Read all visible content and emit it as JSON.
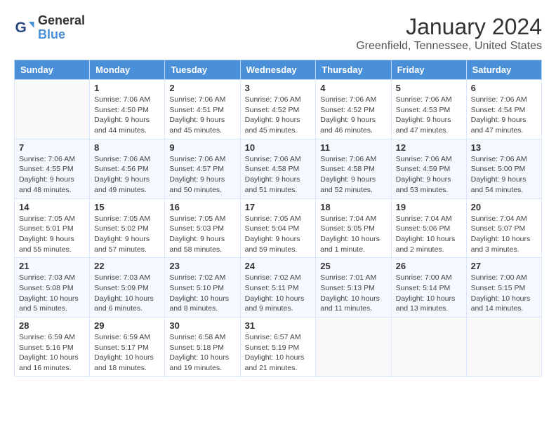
{
  "logo": {
    "line1": "General",
    "line2": "Blue"
  },
  "title": "January 2024",
  "subtitle": "Greenfield, Tennessee, United States",
  "weekdays": [
    "Sunday",
    "Monday",
    "Tuesday",
    "Wednesday",
    "Thursday",
    "Friday",
    "Saturday"
  ],
  "weeks": [
    [
      {
        "date": "",
        "info": ""
      },
      {
        "date": "1",
        "info": "Sunrise: 7:06 AM\nSunset: 4:50 PM\nDaylight: 9 hours\nand 44 minutes."
      },
      {
        "date": "2",
        "info": "Sunrise: 7:06 AM\nSunset: 4:51 PM\nDaylight: 9 hours\nand 45 minutes."
      },
      {
        "date": "3",
        "info": "Sunrise: 7:06 AM\nSunset: 4:52 PM\nDaylight: 9 hours\nand 45 minutes."
      },
      {
        "date": "4",
        "info": "Sunrise: 7:06 AM\nSunset: 4:52 PM\nDaylight: 9 hours\nand 46 minutes."
      },
      {
        "date": "5",
        "info": "Sunrise: 7:06 AM\nSunset: 4:53 PM\nDaylight: 9 hours\nand 47 minutes."
      },
      {
        "date": "6",
        "info": "Sunrise: 7:06 AM\nSunset: 4:54 PM\nDaylight: 9 hours\nand 47 minutes."
      }
    ],
    [
      {
        "date": "7",
        "info": "Sunrise: 7:06 AM\nSunset: 4:55 PM\nDaylight: 9 hours\nand 48 minutes."
      },
      {
        "date": "8",
        "info": "Sunrise: 7:06 AM\nSunset: 4:56 PM\nDaylight: 9 hours\nand 49 minutes."
      },
      {
        "date": "9",
        "info": "Sunrise: 7:06 AM\nSunset: 4:57 PM\nDaylight: 9 hours\nand 50 minutes."
      },
      {
        "date": "10",
        "info": "Sunrise: 7:06 AM\nSunset: 4:58 PM\nDaylight: 9 hours\nand 51 minutes."
      },
      {
        "date": "11",
        "info": "Sunrise: 7:06 AM\nSunset: 4:58 PM\nDaylight: 9 hours\nand 52 minutes."
      },
      {
        "date": "12",
        "info": "Sunrise: 7:06 AM\nSunset: 4:59 PM\nDaylight: 9 hours\nand 53 minutes."
      },
      {
        "date": "13",
        "info": "Sunrise: 7:06 AM\nSunset: 5:00 PM\nDaylight: 9 hours\nand 54 minutes."
      }
    ],
    [
      {
        "date": "14",
        "info": "Sunrise: 7:05 AM\nSunset: 5:01 PM\nDaylight: 9 hours\nand 55 minutes."
      },
      {
        "date": "15",
        "info": "Sunrise: 7:05 AM\nSunset: 5:02 PM\nDaylight: 9 hours\nand 57 minutes."
      },
      {
        "date": "16",
        "info": "Sunrise: 7:05 AM\nSunset: 5:03 PM\nDaylight: 9 hours\nand 58 minutes."
      },
      {
        "date": "17",
        "info": "Sunrise: 7:05 AM\nSunset: 5:04 PM\nDaylight: 9 hours\nand 59 minutes."
      },
      {
        "date": "18",
        "info": "Sunrise: 7:04 AM\nSunset: 5:05 PM\nDaylight: 10 hours\nand 1 minute."
      },
      {
        "date": "19",
        "info": "Sunrise: 7:04 AM\nSunset: 5:06 PM\nDaylight: 10 hours\nand 2 minutes."
      },
      {
        "date": "20",
        "info": "Sunrise: 7:04 AM\nSunset: 5:07 PM\nDaylight: 10 hours\nand 3 minutes."
      }
    ],
    [
      {
        "date": "21",
        "info": "Sunrise: 7:03 AM\nSunset: 5:08 PM\nDaylight: 10 hours\nand 5 minutes."
      },
      {
        "date": "22",
        "info": "Sunrise: 7:03 AM\nSunset: 5:09 PM\nDaylight: 10 hours\nand 6 minutes."
      },
      {
        "date": "23",
        "info": "Sunrise: 7:02 AM\nSunset: 5:10 PM\nDaylight: 10 hours\nand 8 minutes."
      },
      {
        "date": "24",
        "info": "Sunrise: 7:02 AM\nSunset: 5:11 PM\nDaylight: 10 hours\nand 9 minutes."
      },
      {
        "date": "25",
        "info": "Sunrise: 7:01 AM\nSunset: 5:13 PM\nDaylight: 10 hours\nand 11 minutes."
      },
      {
        "date": "26",
        "info": "Sunrise: 7:00 AM\nSunset: 5:14 PM\nDaylight: 10 hours\nand 13 minutes."
      },
      {
        "date": "27",
        "info": "Sunrise: 7:00 AM\nSunset: 5:15 PM\nDaylight: 10 hours\nand 14 minutes."
      }
    ],
    [
      {
        "date": "28",
        "info": "Sunrise: 6:59 AM\nSunset: 5:16 PM\nDaylight: 10 hours\nand 16 minutes."
      },
      {
        "date": "29",
        "info": "Sunrise: 6:59 AM\nSunset: 5:17 PM\nDaylight: 10 hours\nand 18 minutes."
      },
      {
        "date": "30",
        "info": "Sunrise: 6:58 AM\nSunset: 5:18 PM\nDaylight: 10 hours\nand 19 minutes."
      },
      {
        "date": "31",
        "info": "Sunrise: 6:57 AM\nSunset: 5:19 PM\nDaylight: 10 hours\nand 21 minutes."
      },
      {
        "date": "",
        "info": ""
      },
      {
        "date": "",
        "info": ""
      },
      {
        "date": "",
        "info": ""
      }
    ]
  ]
}
